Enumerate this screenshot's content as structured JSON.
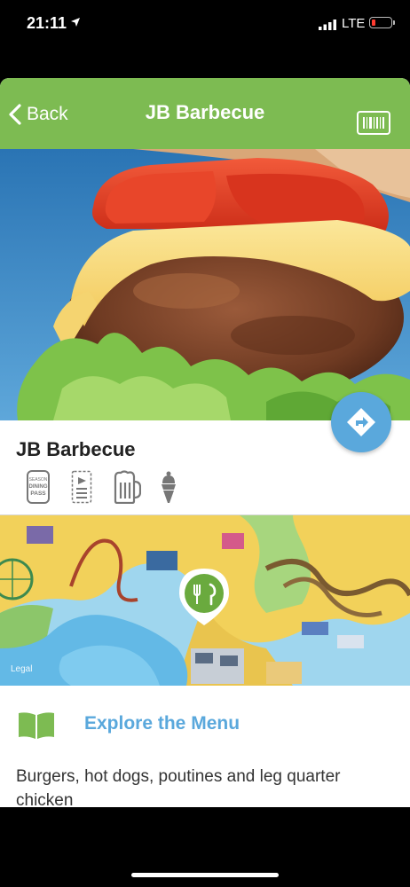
{
  "status": {
    "time": "21:11",
    "network": "LTE"
  },
  "nav": {
    "back_label": "Back",
    "title": "JB Barbecue"
  },
  "restaurant": {
    "name": "JB Barbecue",
    "amenities": [
      "season-dining-pass-icon",
      "quick-service-icon",
      "beer-icon",
      "ice-cream-icon"
    ],
    "season_pass_text": [
      "SEASON",
      "DINING",
      "PASS"
    ]
  },
  "map": {
    "legal_label": "Legal"
  },
  "menu": {
    "label": "Explore the Menu"
  },
  "description": "Burgers, hot dogs, poutines and leg quarter chicken",
  "colors": {
    "nav_green": "#7dbb52",
    "accent_blue": "#5aa8dc",
    "marker_green": "#6aaa3e"
  }
}
